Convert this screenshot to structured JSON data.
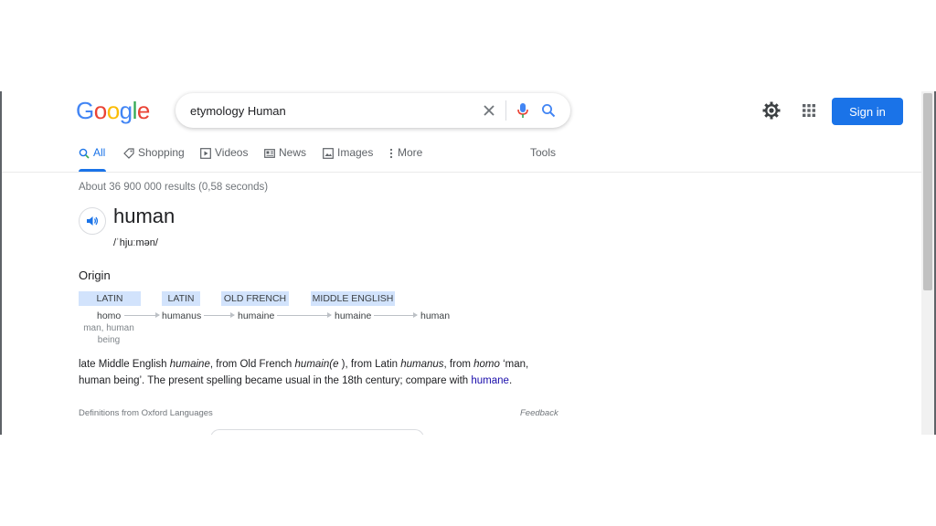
{
  "logo": {
    "letters": [
      "G",
      "o",
      "o",
      "g",
      "l",
      "e"
    ],
    "colors": [
      "#4285f4",
      "#ea4335",
      "#fbbc05",
      "#4285f4",
      "#34a853",
      "#ea4335"
    ]
  },
  "search": {
    "query": "etymology Human"
  },
  "header": {
    "sign_in_label": "Sign in"
  },
  "tabs": [
    {
      "label": "All",
      "icon": "search-icon",
      "active": true
    },
    {
      "label": "Shopping",
      "icon": "tag-icon"
    },
    {
      "label": "Videos",
      "icon": "play-icon"
    },
    {
      "label": "News",
      "icon": "newspaper-icon"
    },
    {
      "label": "Images",
      "icon": "image-icon"
    },
    {
      "label": "More",
      "icon": "kebab-icon"
    },
    {
      "label": "Tools"
    }
  ],
  "result_stats": "About 36 900 000 results (0,58 seconds)",
  "dictionary": {
    "word": "human",
    "phonetic": "/ˈhjuːmən/",
    "origin_title": "Origin",
    "chain": [
      {
        "lang": "LATIN",
        "word": "homo",
        "gloss": "man, human being"
      },
      {
        "lang": "LATIN",
        "word": "humanus"
      },
      {
        "lang": "OLD FRENCH",
        "word": "humaine"
      },
      {
        "lang": "MIDDLE ENGLISH",
        "word": "humaine"
      },
      {
        "lang": "",
        "word": "human"
      }
    ],
    "paragraph": {
      "t1": "late Middle English ",
      "i1": "humaine",
      "t2": ", from Old French ",
      "i2": "humain(e",
      "t3": " ), from Latin ",
      "i3": "humanus",
      "t4": ", from ",
      "i4": "homo",
      "t5": " ‘man, human being’. The present spelling became usual in the 18th century; compare with ",
      "link": "humane",
      "t6": "."
    },
    "source": "Definitions from Oxford Languages",
    "feedback": "Feedback"
  },
  "colors": {
    "accent": "#1a73e8",
    "link": "#1a0dab",
    "lang_chip": "#d2e3fc"
  }
}
